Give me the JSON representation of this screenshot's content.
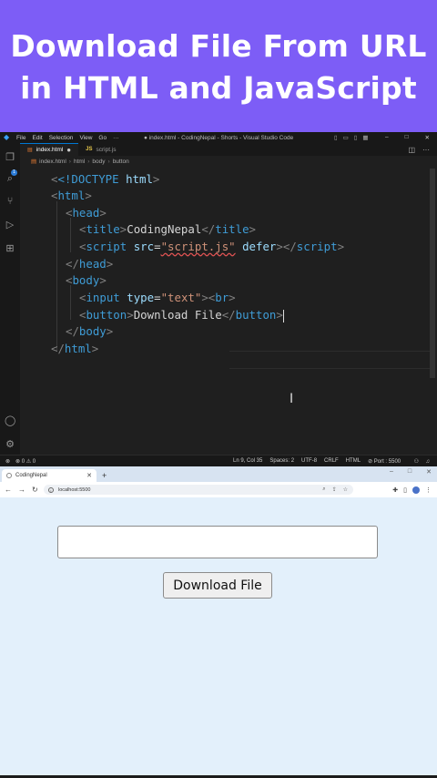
{
  "banner": {
    "title_line1": "Download File From URL",
    "title_line2": "in HTML and JavaScript"
  },
  "vscode": {
    "menu": [
      "File",
      "Edit",
      "Selection",
      "View",
      "Go",
      "···"
    ],
    "window_title": "● index.html - CodingNepal - Shorts - Visual Studio Code",
    "tabs": [
      {
        "label": "index.html",
        "icon": "html-file-icon",
        "modified": true
      },
      {
        "label": "script.js",
        "icon": "js-file-icon",
        "modified": false
      }
    ],
    "breadcrumb": [
      "index.html",
      "html",
      "body",
      "button"
    ],
    "code": {
      "doctype": "<!DOCTYPE",
      "doctype_rest": " html",
      "html": "html",
      "head": "head",
      "title_tag": "title",
      "title_text": "CodingNepal",
      "script_tag": "script",
      "src_attr": "src",
      "src_val": "\"script.js\"",
      "defer": "defer",
      "body": "body",
      "input_tag": "input",
      "type_attr": "type",
      "type_val": "\"text\"",
      "br_tag": "br",
      "button_tag": "button",
      "button_text": "Download File"
    },
    "status": {
      "errors": "0",
      "warnings": "0",
      "position": "Ln 9, Col 35",
      "spaces": "Spaces: 2",
      "encoding": "UTF-8",
      "eol": "CRLF",
      "language": "HTML",
      "port": "Port : 5500"
    }
  },
  "browser": {
    "tab_title": "CodingNepal",
    "url": "localhost:5500",
    "page": {
      "input_value": "",
      "button_label": "Download File"
    }
  },
  "colors": {
    "banner_bg": "#7d5df6",
    "editor_bg": "#1f1f1f",
    "page_bg": "#e3f0fb",
    "accent": "#0078d4"
  }
}
